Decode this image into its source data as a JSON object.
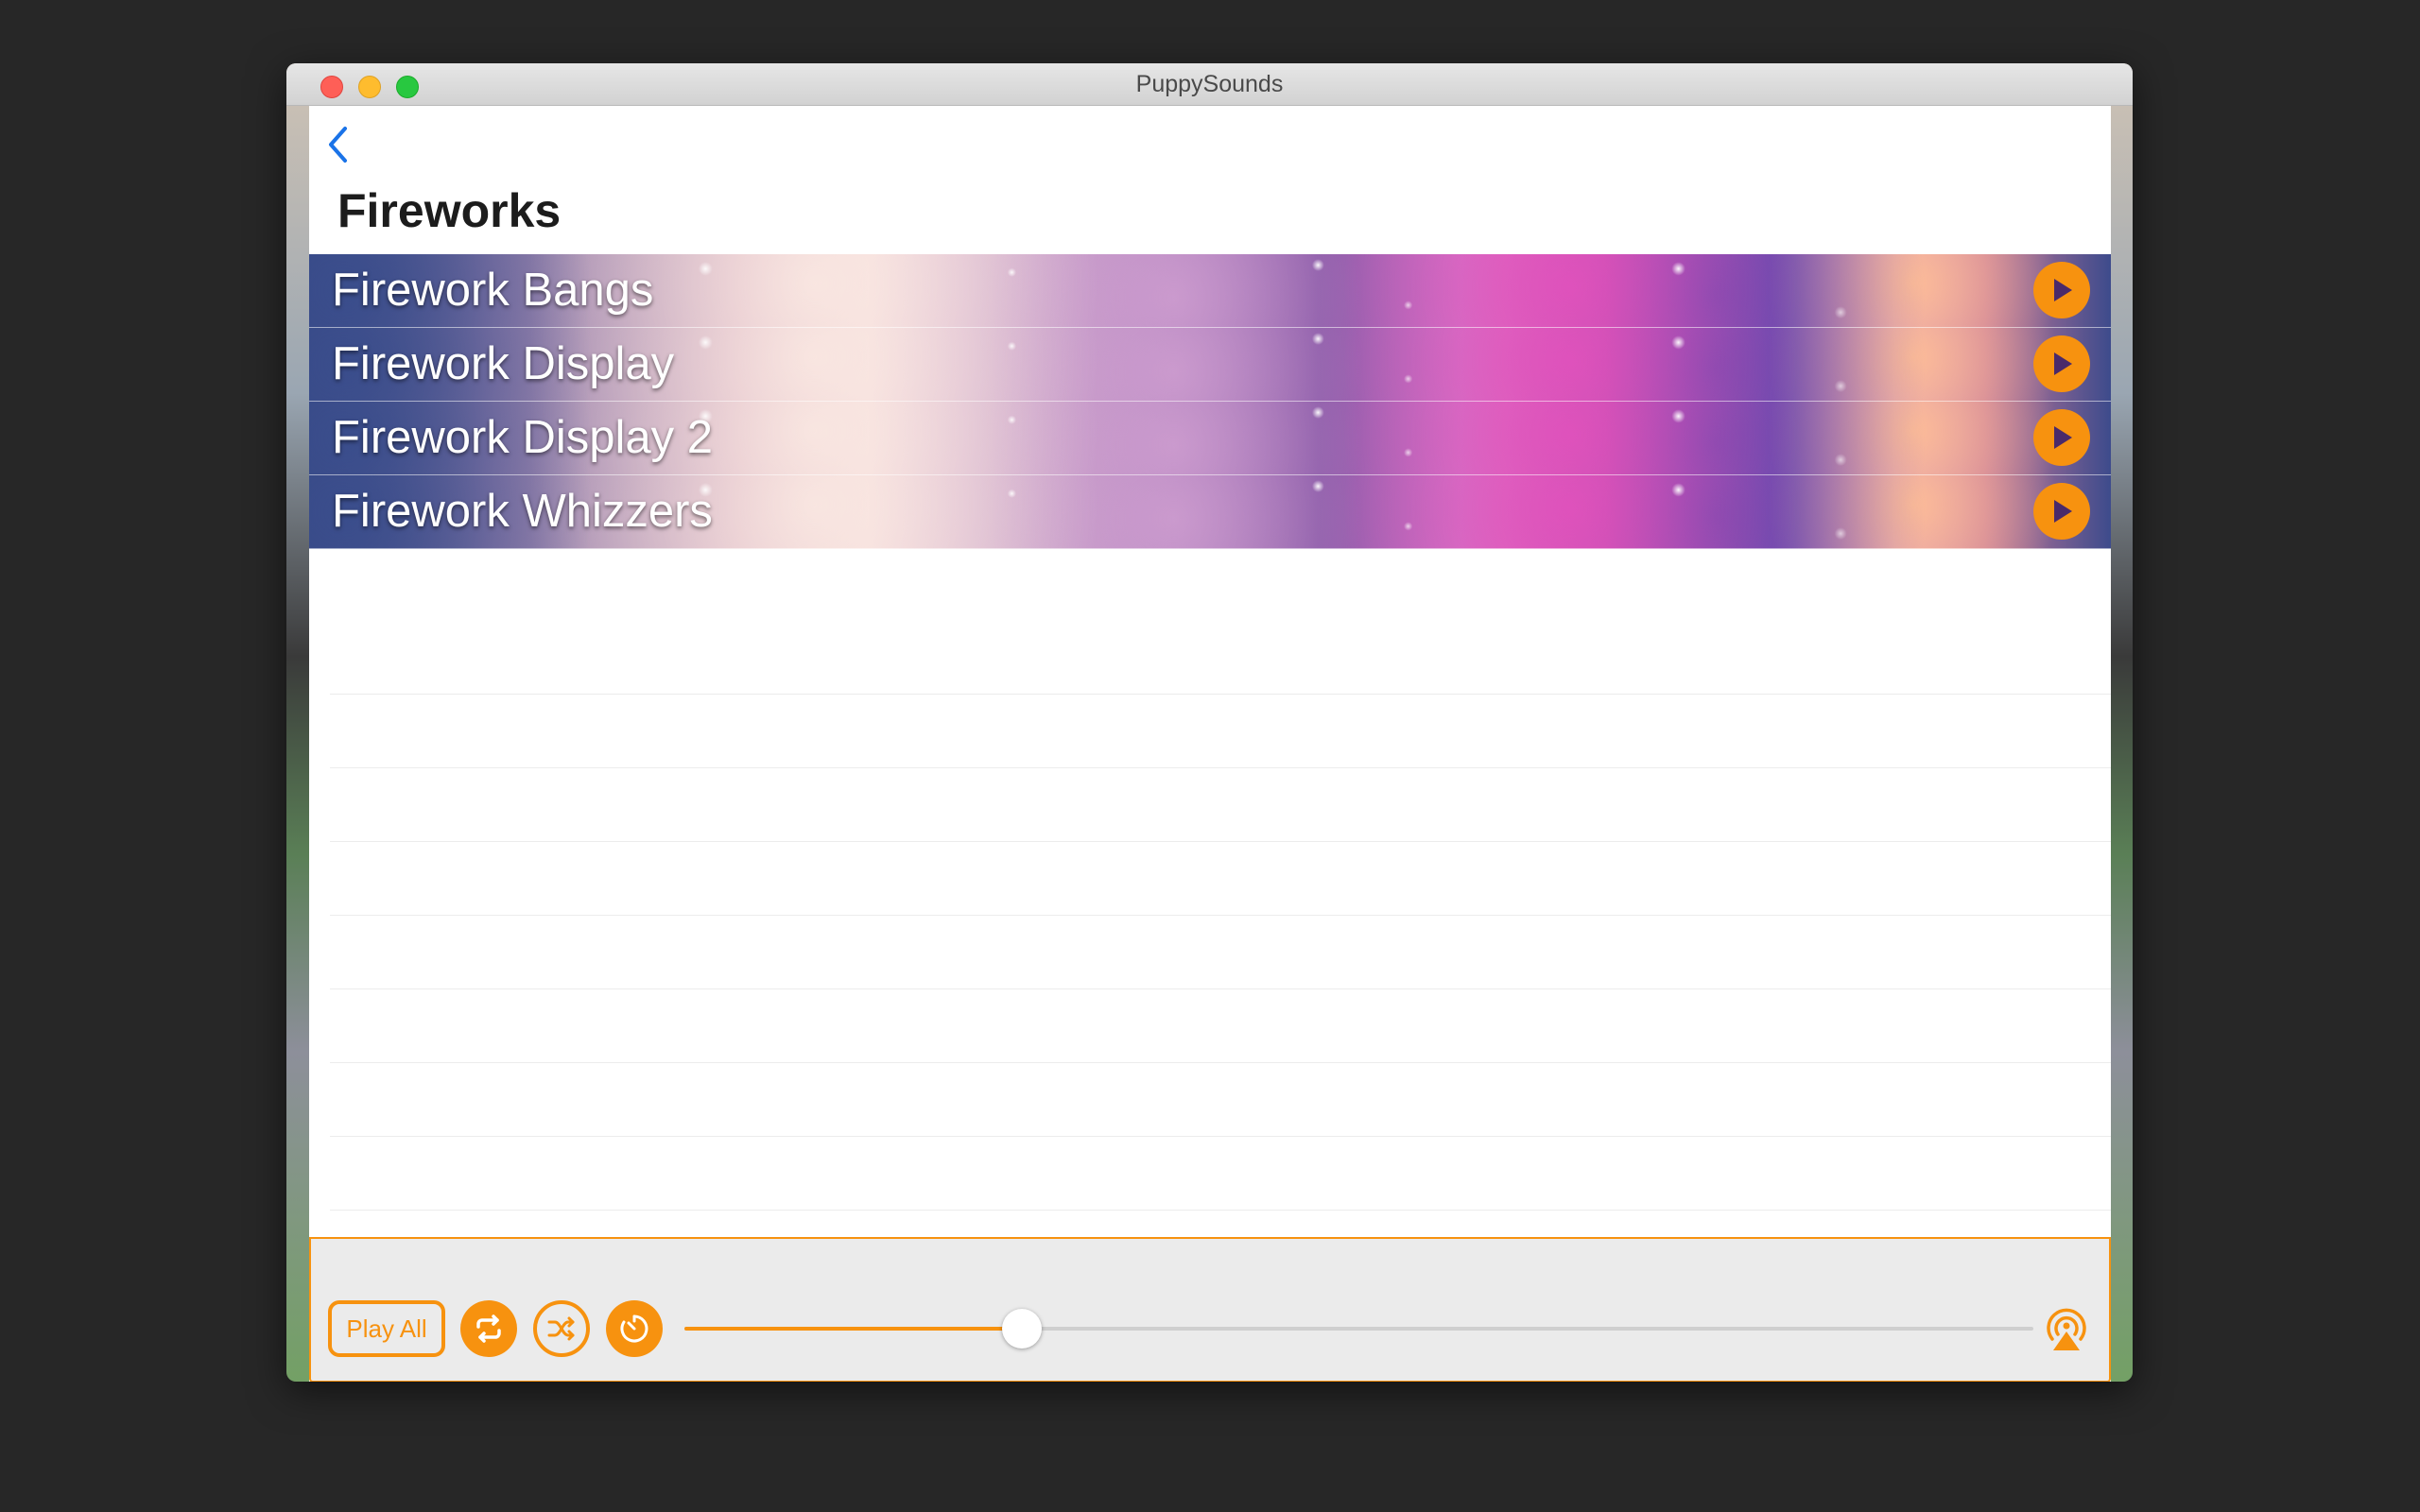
{
  "window": {
    "title": "PuppySounds"
  },
  "nav": {
    "back_icon": "chevron-left-icon"
  },
  "page": {
    "title": "Fireworks"
  },
  "sounds": [
    {
      "label": "Firework Bangs"
    },
    {
      "label": "Firework Display"
    },
    {
      "label": "Firework Display 2"
    },
    {
      "label": "Firework Whizzers"
    }
  ],
  "player": {
    "play_all_label": "Play All",
    "repeat_icon": "repeat-icon",
    "shuffle_icon": "shuffle-icon",
    "timer_icon": "timer-icon",
    "airplay_icon": "airplay-icon",
    "volume": 0.25
  },
  "colors": {
    "accent": "#f7920f",
    "link": "#1a73e8"
  }
}
